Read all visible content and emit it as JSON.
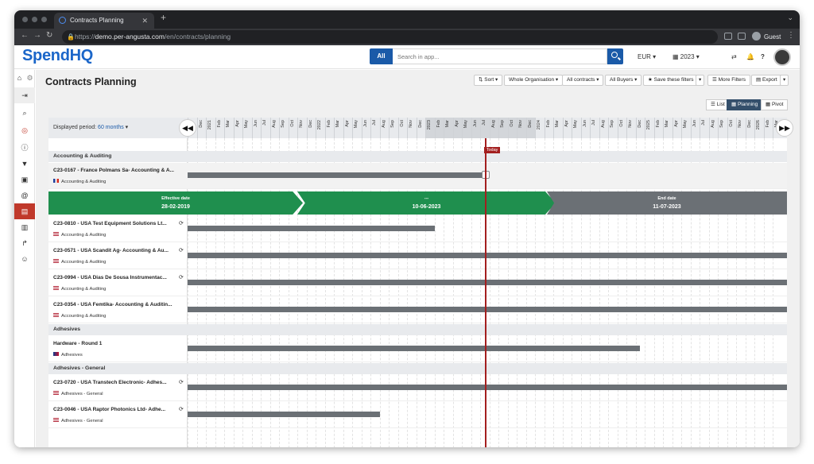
{
  "browser": {
    "tab_title": "Contracts Planning",
    "url_host": "demo.per-angusta.com",
    "url_prefix": "https://",
    "url_path": "/en/contracts/planning",
    "profile": "Guest"
  },
  "header": {
    "logo": "SpendHQ",
    "search_scope": "All",
    "search_placeholder": "Search in app...",
    "currency": "EUR",
    "year": "2023"
  },
  "page": {
    "title": "Contracts Planning",
    "toolbar": [
      "Sort",
      "Whole Organisation",
      "All contracts",
      "All Buyers",
      "Save these filters",
      "More Filters",
      "Export"
    ],
    "views": [
      "List",
      "Planning",
      "Pivot"
    ],
    "active_view": "Planning",
    "displayed_period_label": "Displayed period:",
    "displayed_period_value": "60 months",
    "today_label": "Today"
  },
  "timeline": {
    "months": [
      "Nov",
      "Dec",
      "2021",
      "Feb",
      "Mar",
      "Apr",
      "May",
      "Jun",
      "Jul",
      "Aug",
      "Sep",
      "Oct",
      "Nov",
      "Dec",
      "2022",
      "Feb",
      "Mar",
      "Apr",
      "May",
      "Jun",
      "Jul",
      "Aug",
      "Sep",
      "Oct",
      "Nov",
      "Dec",
      "2023",
      "Feb",
      "Mar",
      "Apr",
      "May",
      "Jun",
      "Jul",
      "Aug",
      "Sep",
      "Oct",
      "Nov",
      "Dec",
      "2024",
      "Feb",
      "Mar",
      "Apr",
      "May",
      "Jun",
      "Jul",
      "Aug",
      "Sep",
      "Oct",
      "Nov",
      "Dec",
      "2025",
      "Feb",
      "Mar",
      "Apr",
      "May",
      "Jun",
      "Jul",
      "Aug",
      "Sep",
      "Oct",
      "Nov",
      "Dec",
      "2026",
      "Feb",
      "Mar"
    ],
    "highlight_range": [
      26,
      37
    ],
    "today_index": 32.5
  },
  "contract_detail": {
    "effective_label": "Effective date",
    "effective_date": "28-02-2019",
    "middle_label": "---",
    "middle_date": "10-06-2023",
    "end_label": "End date",
    "end_date": "11-07-2023"
  },
  "groups": [
    {
      "name": "Accounting & Auditing",
      "rows": [
        {
          "name": "C23-0167 - France Polmans Sa- Accounting & A...",
          "category": "Accounting & Auditing",
          "flag": "fr",
          "sync": false,
          "bar_start": 0,
          "bar_end": 32.6,
          "selected": true
        }
      ]
    },
    {
      "name": "",
      "rows": [
        {
          "name": "C23-0810 - USA Test Equipment Solutions Lt...",
          "category": "Accounting & Auditing",
          "flag": "us",
          "sync": true,
          "bar_start": 0,
          "bar_end": 27
        },
        {
          "name": "C23-0571 - USA Scandit Ag- Accounting & Au...",
          "category": "Accounting & Auditing",
          "flag": "us",
          "sync": true,
          "bar_start": 0,
          "bar_end": 66
        },
        {
          "name": "C23-0994 - USA Dias De Sousa Instrumentac...",
          "category": "Accounting & Auditing",
          "flag": "us",
          "sync": true,
          "bar_start": 0,
          "bar_end": 66
        },
        {
          "name": "C23-0354 - USA Femtika- Accounting & Auditin...",
          "category": "Accounting & Auditing",
          "flag": "us",
          "sync": false,
          "bar_start": 0,
          "bar_end": 66
        }
      ]
    },
    {
      "name": "Adhesives",
      "rows": [
        {
          "name": "Hardware - Round 1",
          "category": "Adhesives",
          "flag": "uk",
          "sync": false,
          "bar_start": 0,
          "bar_end": 49.5
        }
      ]
    },
    {
      "name": "Adhesives - General",
      "rows": [
        {
          "name": "C23-0720 - USA Transtech Electronic- Adhes...",
          "category": "Adhesives - General",
          "flag": "us",
          "sync": true,
          "bar_start": 0,
          "bar_end": 66
        },
        {
          "name": "C23-0046 - USA Raptor Photonics Ltd- Adhe...",
          "category": "Adhesives - General",
          "flag": "us",
          "sync": true,
          "bar_start": 0,
          "bar_end": 21
        }
      ]
    }
  ],
  "colors": {
    "accent": "#1a5aa8",
    "today": "#a31f1f",
    "chevron_green": "#1f8f4e",
    "chevron_grey": "#6b7075",
    "bar": "#6b7075"
  }
}
